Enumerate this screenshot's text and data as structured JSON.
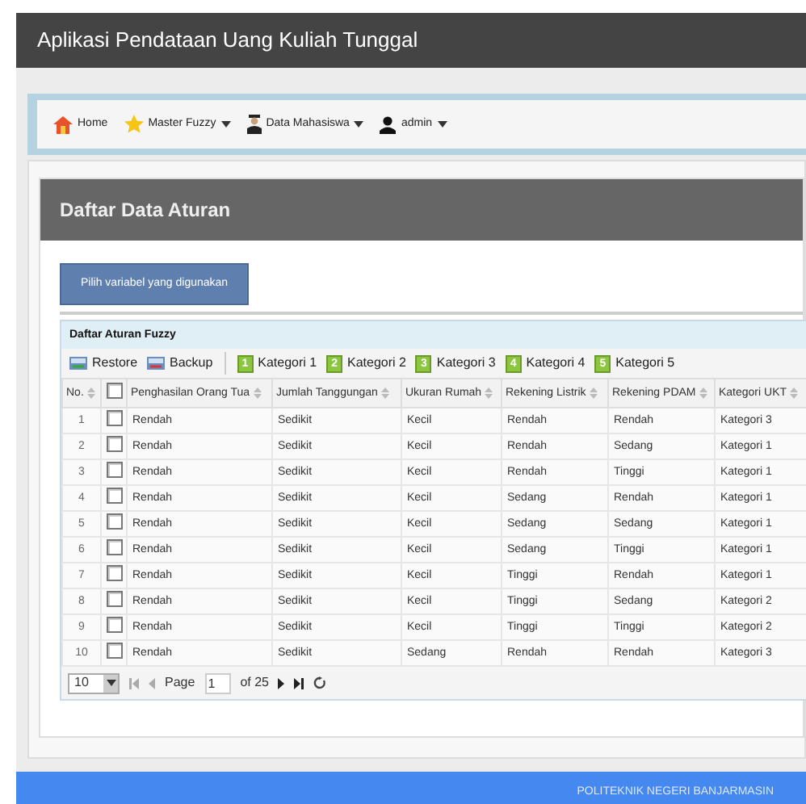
{
  "app_title": "Aplikasi Pendataan Uang Kuliah Tunggal",
  "nav": [
    {
      "kind": "home",
      "label": "Home",
      "dropdown": false
    },
    {
      "kind": "star",
      "label": "Master Fuzzy",
      "dropdown": true
    },
    {
      "kind": "student",
      "label": "Data Mahasiswa",
      "dropdown": true
    },
    {
      "kind": "user",
      "label": "admin",
      "dropdown": true
    }
  ],
  "panel_title": "Daftar Data Aturan",
  "choose_button": "Pilih variabel yang digunakan",
  "grid": {
    "title": "Daftar Aturan Fuzzy",
    "toolbar": [
      {
        "kind": "restore",
        "label": "Restore"
      },
      {
        "kind": "backup",
        "label": "Backup"
      },
      {
        "kind": "separator"
      },
      {
        "kind": "badge",
        "badge": "1",
        "label": "Kategori 1"
      },
      {
        "kind": "badge",
        "badge": "2",
        "label": "Kategori 2"
      },
      {
        "kind": "badge",
        "badge": "3",
        "label": "Kategori 3"
      },
      {
        "kind": "badge",
        "badge": "4",
        "label": "Kategori 4"
      },
      {
        "kind": "badge",
        "badge": "5",
        "label": "Kategori 5"
      }
    ],
    "columns": [
      {
        "kind": "text",
        "label": "No."
      },
      {
        "kind": "checkbox",
        "checked": false
      },
      {
        "kind": "text",
        "label": "Penghasilan Orang Tua"
      },
      {
        "kind": "text",
        "label": "Jumlah Tanggungan"
      },
      {
        "kind": "text",
        "label": "Ukuran Rumah"
      },
      {
        "kind": "text",
        "label": "Rekening Listrik"
      },
      {
        "kind": "text",
        "label": "Rekening PDAM"
      },
      {
        "kind": "text",
        "label": "Kategori UKT"
      }
    ],
    "rows": [
      {
        "cells": [
          {
            "kind": "number",
            "text": "1"
          },
          {
            "kind": "checkbox",
            "checked": false
          },
          {
            "kind": "text",
            "text": "Rendah"
          },
          {
            "kind": "text",
            "text": "Sedikit"
          },
          {
            "kind": "text",
            "text": "Kecil"
          },
          {
            "kind": "text",
            "text": "Rendah"
          },
          {
            "kind": "text",
            "text": "Rendah"
          },
          {
            "kind": "text",
            "text": "Kategori 3"
          }
        ]
      },
      {
        "cells": [
          {
            "kind": "number",
            "text": "2"
          },
          {
            "kind": "checkbox",
            "checked": false
          },
          {
            "kind": "text",
            "text": "Rendah"
          },
          {
            "kind": "text",
            "text": "Sedikit"
          },
          {
            "kind": "text",
            "text": "Kecil"
          },
          {
            "kind": "text",
            "text": "Rendah"
          },
          {
            "kind": "text",
            "text": "Sedang"
          },
          {
            "kind": "text",
            "text": "Kategori 1"
          }
        ]
      },
      {
        "cells": [
          {
            "kind": "number",
            "text": "3"
          },
          {
            "kind": "checkbox",
            "checked": false
          },
          {
            "kind": "text",
            "text": "Rendah"
          },
          {
            "kind": "text",
            "text": "Sedikit"
          },
          {
            "kind": "text",
            "text": "Kecil"
          },
          {
            "kind": "text",
            "text": "Rendah"
          },
          {
            "kind": "text",
            "text": "Tinggi"
          },
          {
            "kind": "text",
            "text": "Kategori 1"
          }
        ]
      },
      {
        "cells": [
          {
            "kind": "number",
            "text": "4"
          },
          {
            "kind": "checkbox",
            "checked": false
          },
          {
            "kind": "text",
            "text": "Rendah"
          },
          {
            "kind": "text",
            "text": "Sedikit"
          },
          {
            "kind": "text",
            "text": "Kecil"
          },
          {
            "kind": "text",
            "text": "Sedang"
          },
          {
            "kind": "text",
            "text": "Rendah"
          },
          {
            "kind": "text",
            "text": "Kategori 1"
          }
        ]
      },
      {
        "cells": [
          {
            "kind": "number",
            "text": "5"
          },
          {
            "kind": "checkbox",
            "checked": false
          },
          {
            "kind": "text",
            "text": "Rendah"
          },
          {
            "kind": "text",
            "text": "Sedikit"
          },
          {
            "kind": "text",
            "text": "Kecil"
          },
          {
            "kind": "text",
            "text": "Sedang"
          },
          {
            "kind": "text",
            "text": "Sedang"
          },
          {
            "kind": "text",
            "text": "Kategori 1"
          }
        ]
      },
      {
        "cells": [
          {
            "kind": "number",
            "text": "6"
          },
          {
            "kind": "checkbox",
            "checked": false
          },
          {
            "kind": "text",
            "text": "Rendah"
          },
          {
            "kind": "text",
            "text": "Sedikit"
          },
          {
            "kind": "text",
            "text": "Kecil"
          },
          {
            "kind": "text",
            "text": "Sedang"
          },
          {
            "kind": "text",
            "text": "Tinggi"
          },
          {
            "kind": "text",
            "text": "Kategori 1"
          }
        ]
      },
      {
        "cells": [
          {
            "kind": "number",
            "text": "7"
          },
          {
            "kind": "checkbox",
            "checked": false
          },
          {
            "kind": "text",
            "text": "Rendah"
          },
          {
            "kind": "text",
            "text": "Sedikit"
          },
          {
            "kind": "text",
            "text": "Kecil"
          },
          {
            "kind": "text",
            "text": "Tinggi"
          },
          {
            "kind": "text",
            "text": "Rendah"
          },
          {
            "kind": "text",
            "text": "Kategori 1"
          }
        ]
      },
      {
        "cells": [
          {
            "kind": "number",
            "text": "8"
          },
          {
            "kind": "checkbox",
            "checked": false
          },
          {
            "kind": "text",
            "text": "Rendah"
          },
          {
            "kind": "text",
            "text": "Sedikit"
          },
          {
            "kind": "text",
            "text": "Kecil"
          },
          {
            "kind": "text",
            "text": "Tinggi"
          },
          {
            "kind": "text",
            "text": "Sedang"
          },
          {
            "kind": "text",
            "text": "Kategori 2"
          }
        ]
      },
      {
        "cells": [
          {
            "kind": "number",
            "text": "9"
          },
          {
            "kind": "checkbox",
            "checked": false
          },
          {
            "kind": "text",
            "text": "Rendah"
          },
          {
            "kind": "text",
            "text": "Sedikit"
          },
          {
            "kind": "text",
            "text": "Kecil"
          },
          {
            "kind": "text",
            "text": "Tinggi"
          },
          {
            "kind": "text",
            "text": "Tinggi"
          },
          {
            "kind": "text",
            "text": "Kategori 2"
          }
        ]
      },
      {
        "cells": [
          {
            "kind": "number",
            "text": "10"
          },
          {
            "kind": "checkbox",
            "checked": false
          },
          {
            "kind": "text",
            "text": "Rendah"
          },
          {
            "kind": "text",
            "text": "Sedikit"
          },
          {
            "kind": "text",
            "text": "Sedang"
          },
          {
            "kind": "text",
            "text": "Rendah"
          },
          {
            "kind": "text",
            "text": "Rendah"
          },
          {
            "kind": "text",
            "text": "Kategori 3"
          }
        ]
      }
    ],
    "pager": {
      "page_size": "10",
      "page_label": "Page",
      "page": "1",
      "of_label": "of 25"
    }
  },
  "footer": "POLITEKNIK NEGERI BANJARMASIN"
}
